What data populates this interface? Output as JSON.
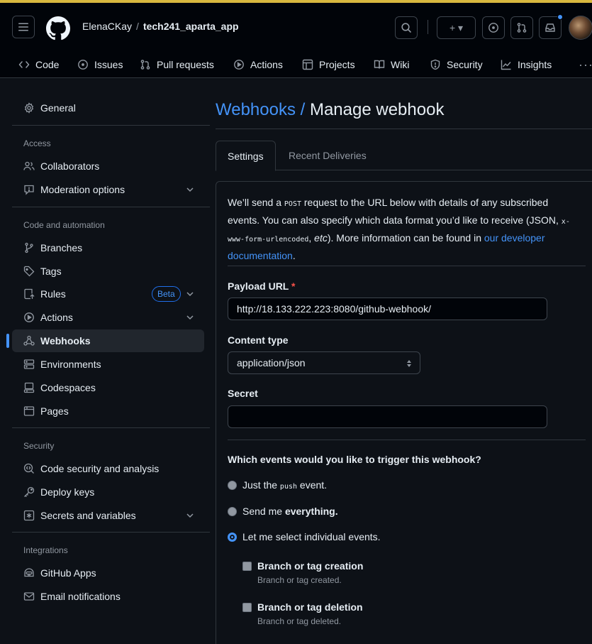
{
  "header": {
    "owner": "ElenaCKay",
    "separator": "/",
    "repo": "tech241_aparta_app",
    "add_label": "+ ▾"
  },
  "nav_tabs": [
    {
      "label": "Code",
      "icon": "code-icon"
    },
    {
      "label": "Issues",
      "icon": "issue-opened-icon"
    },
    {
      "label": "Pull requests",
      "icon": "git-pull-request-icon"
    },
    {
      "label": "Actions",
      "icon": "play-icon"
    },
    {
      "label": "Projects",
      "icon": "table-icon"
    },
    {
      "label": "Wiki",
      "icon": "book-icon"
    },
    {
      "label": "Security",
      "icon": "shield-icon"
    },
    {
      "label": "Insights",
      "icon": "graph-icon"
    }
  ],
  "sidebar": {
    "general": "General",
    "sections": {
      "access": "Access",
      "code_automation": "Code and automation",
      "security": "Security",
      "integrations": "Integrations"
    },
    "items": {
      "collaborators": "Collaborators",
      "moderation": "Moderation options",
      "branches": "Branches",
      "tags": "Tags",
      "rules": "Rules",
      "rules_badge": "Beta",
      "actions": "Actions",
      "webhooks": "Webhooks",
      "environments": "Environments",
      "codespaces": "Codespaces",
      "pages": "Pages",
      "code_security": "Code security and analysis",
      "deploy_keys": "Deploy keys",
      "secrets": "Secrets and variables",
      "github_apps": "GitHub Apps",
      "email_notifications": "Email notifications"
    }
  },
  "main": {
    "crumb": "Webhooks /",
    "title": "Manage webhook",
    "tabs": [
      "Settings",
      "Recent Deliveries"
    ],
    "intro": {
      "p1": "We’ll send a ",
      "post": "POST",
      "p2": " request to the URL below with details of any subscribed events. You can also specify which data format you’d like to receive (JSON, ",
      "form": "x-www-form-urlencoded",
      "p3": ", ",
      "etc": "etc",
      "p4": "). More information can be found in ",
      "link": "our developer documentation",
      "p5": "."
    },
    "payload_label": "Payload URL",
    "required_mark": "*",
    "payload_url": "http://18.133.222.223:8080/github-webhook/",
    "content_type_label": "Content type",
    "content_type": "application/json",
    "secret_label": "Secret",
    "secret_value": "",
    "events_question": "Which events would you like to trigger this webhook?",
    "radio_push_a": "Just the ",
    "radio_push_code": "push",
    "radio_push_b": " event.",
    "radio_all_a": "Send me ",
    "radio_all_b": "everything.",
    "radio_select": "Let me select individual events.",
    "events": [
      {
        "title": "Branch or tag creation",
        "desc": "Branch or tag created."
      },
      {
        "title": "Branch or tag deletion",
        "desc": "Branch or tag deleted."
      }
    ]
  }
}
